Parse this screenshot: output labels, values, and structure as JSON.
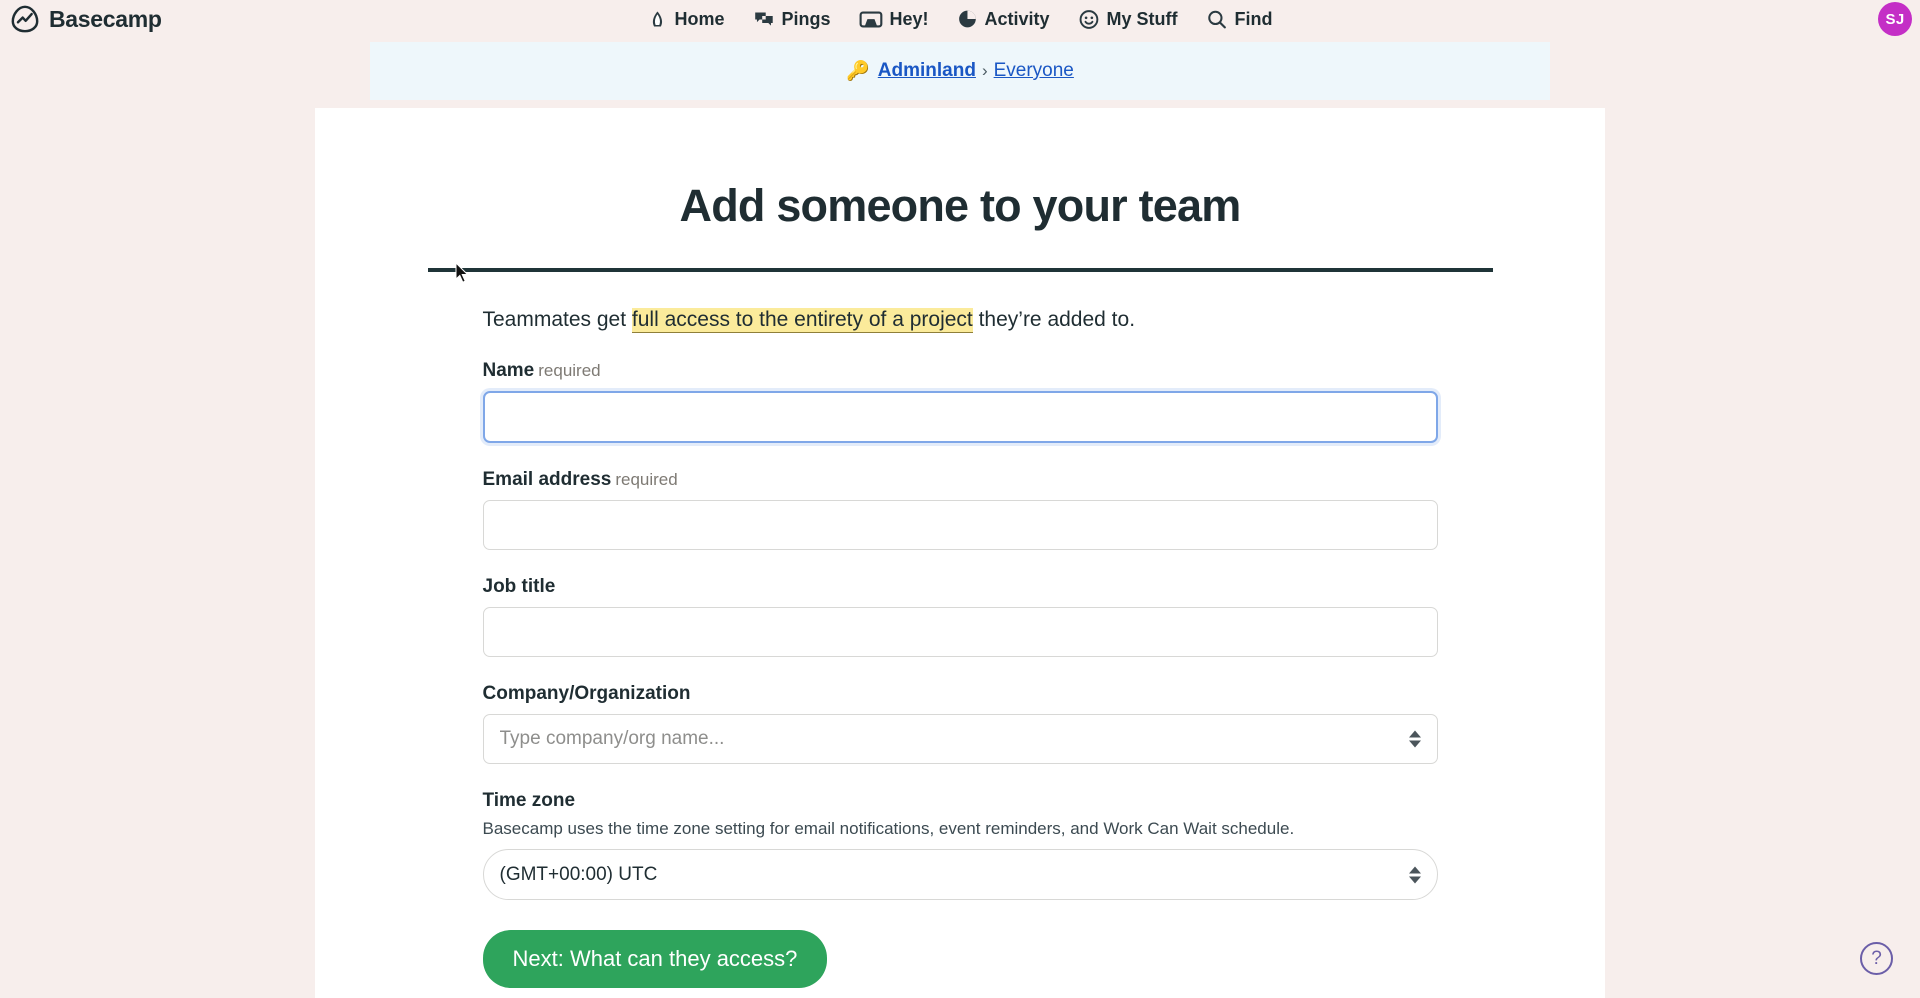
{
  "brand": {
    "name": "Basecamp",
    "logo_icon": "basecamp-logo-icon"
  },
  "nav": {
    "items": [
      {
        "label": "Home",
        "icon": "home-icon"
      },
      {
        "label": "Pings",
        "icon": "chat-bubbles-icon"
      },
      {
        "label": "Hey!",
        "icon": "inbox-tray-icon"
      },
      {
        "label": "Activity",
        "icon": "pie-clock-icon"
      },
      {
        "label": "My Stuff",
        "icon": "smiley-face-icon"
      },
      {
        "label": "Find",
        "icon": "search-icon"
      }
    ],
    "avatar_initials": "SJ",
    "avatar_color": "#c42ec6"
  },
  "breadcrumb": {
    "key_icon": "key-icon",
    "first": "Adminland",
    "separator": "›",
    "second": "Everyone",
    "link_color": "#1a57c4"
  },
  "page": {
    "title": "Add someone to your team",
    "lead_before": "Teammates get ",
    "lead_highlight": "full access to the entirety of a project",
    "lead_after": " they’re added to.",
    "highlight_color": "#fbeb9b"
  },
  "form": {
    "name": {
      "label": "Name",
      "required_note": "required",
      "value": "",
      "placeholder": "",
      "focused": true
    },
    "email": {
      "label": "Email address",
      "required_note": "required",
      "value": "",
      "placeholder": ""
    },
    "job_title": {
      "label": "Job title",
      "value": "",
      "placeholder": ""
    },
    "company": {
      "label": "Company/Organization",
      "value": "",
      "placeholder": "Type company/org name..."
    },
    "timezone": {
      "label": "Time zone",
      "help": "Basecamp uses the time zone setting for email notifications, event reminders, and Work Can Wait schedule.",
      "value": "(GMT+00:00) UTC"
    },
    "submit_label": "Next: What can they access?",
    "submit_color": "#2ea45c"
  },
  "help": {
    "label": "?",
    "icon": "question-mark-icon"
  }
}
